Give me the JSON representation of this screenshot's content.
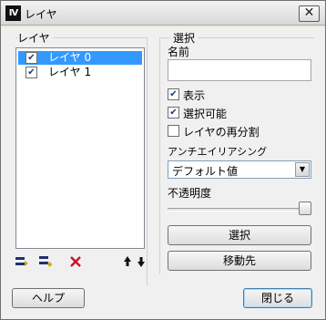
{
  "window": {
    "title": "レイヤ",
    "app_icon": "IV"
  },
  "layers_group": {
    "label": "レイヤ",
    "items": [
      {
        "name": "レイヤ 0",
        "visible": true,
        "selected": true
      },
      {
        "name": "レイヤ 1",
        "visible": true,
        "selected": false
      }
    ],
    "tools": [
      "add-layer-icon",
      "insert-layer-icon",
      "delete-icon",
      "move-up-icon",
      "move-down-icon"
    ]
  },
  "selection_group": {
    "label": "選択",
    "name_label": "名前",
    "name_value": "",
    "show_label": "表示",
    "show_checked": true,
    "selectable_label": "選択可能",
    "selectable_checked": true,
    "subdivide_label": "レイヤの再分割",
    "subdivide_checked": false,
    "antialias_label": "アンチエイリアシング",
    "antialias_value": "デフォルト値",
    "opacity_label": "不透明度",
    "opacity_value": 1.0,
    "select_button": "選択",
    "move_button": "移動先"
  },
  "footer": {
    "help_button": "ヘルプ",
    "close_button": "閉じる"
  }
}
